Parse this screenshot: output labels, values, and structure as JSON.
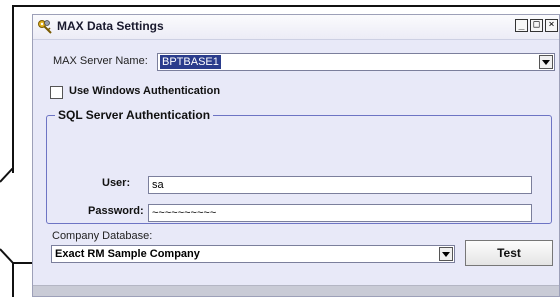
{
  "window": {
    "title": "MAX Data Settings",
    "icon": "keys-icon",
    "controls": {
      "minimize": "_",
      "maximize": "□",
      "close": "×"
    }
  },
  "server": {
    "label": "MAX Server Name:",
    "value": "BPTBASE1"
  },
  "windows_auth": {
    "label": "Use Windows Authentication",
    "checked": false
  },
  "sql_auth": {
    "group_title": "SQL Server Authentication",
    "user_label": "User:",
    "user_value": "sa",
    "password_label": "Password:",
    "password_value": "~~~~~~~~~~"
  },
  "company": {
    "label": "Company Database:",
    "value": "Exact RM Sample Company"
  },
  "test_button": {
    "label": "Test"
  },
  "colors": {
    "window_bg": "#e8e9f8",
    "group_border": "#6d74c4",
    "selection": "#2a3c8c"
  }
}
